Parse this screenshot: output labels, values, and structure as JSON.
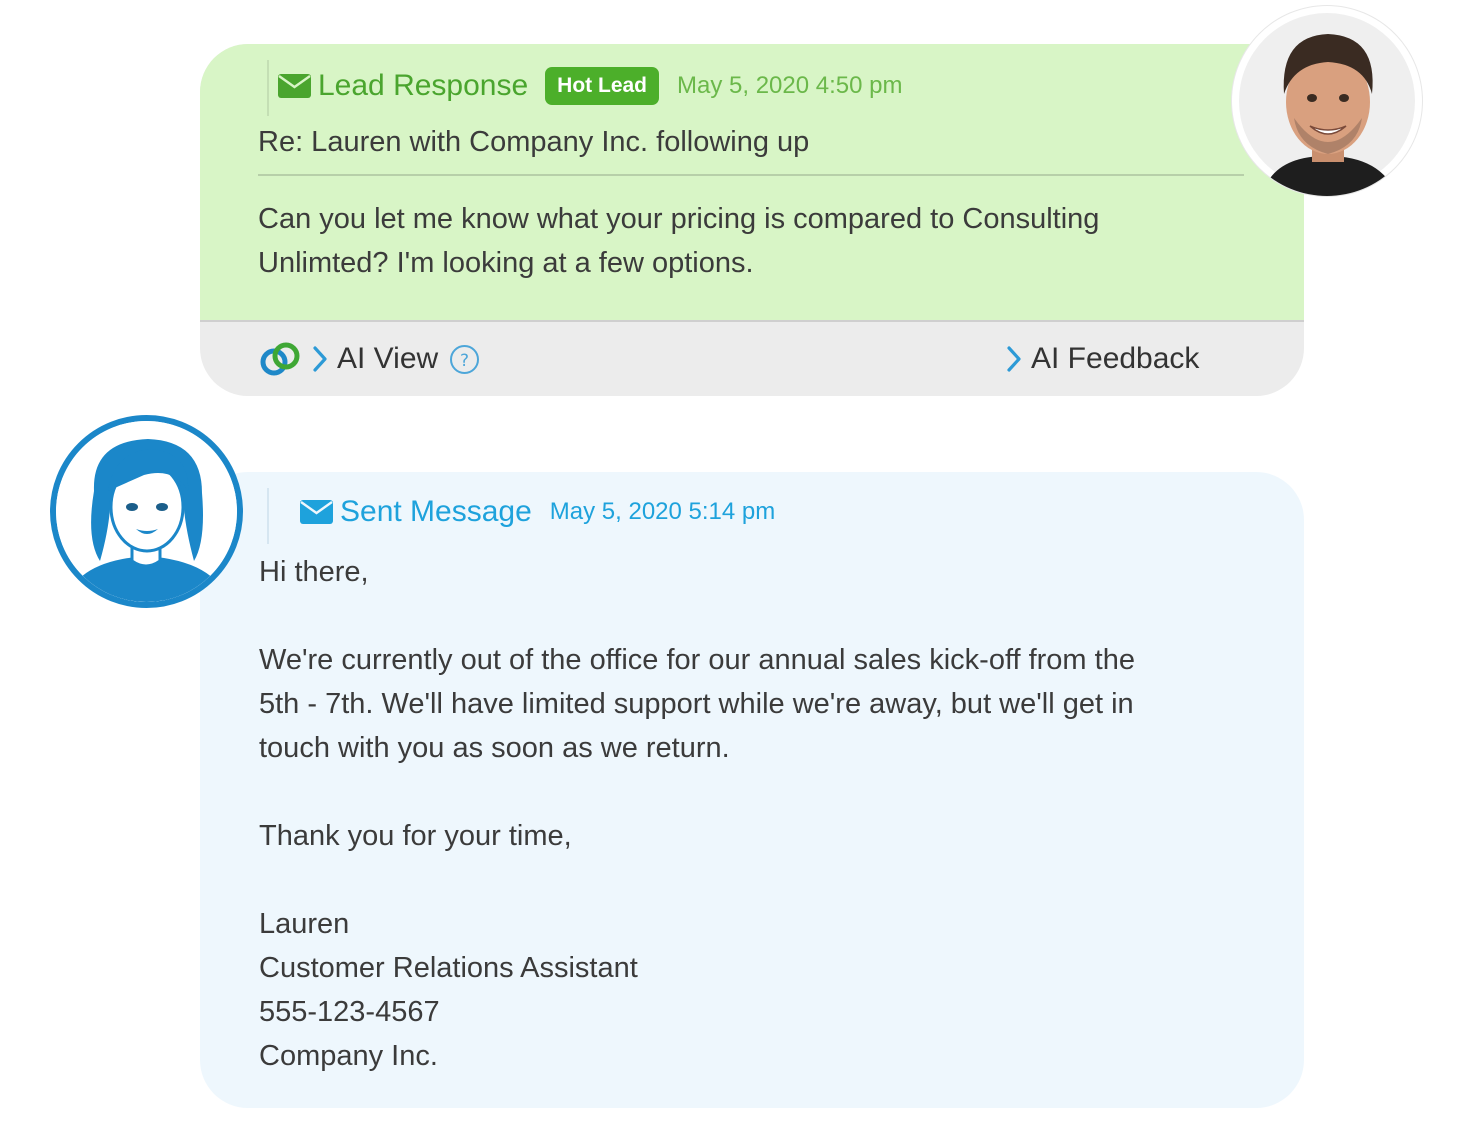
{
  "lead_response": {
    "title": "Lead Response",
    "badge": "Hot Lead",
    "timestamp": "May 5, 2020 4:50 pm",
    "subject": "Re: Lauren with Company Inc. following up",
    "message": "Can you let me know what your pricing is compared to Consulting Unlimted? I'm looking at a few options.",
    "footer": {
      "ai_view_label": "AI View",
      "ai_feedback_label": "AI Feedback"
    },
    "icons": [
      "envelope-icon",
      "ai-logo-icon",
      "chevron-right-icon",
      "help-icon"
    ],
    "colors": {
      "background": "#d8f5c6",
      "accent": "#4aa52e",
      "badge": "#4caf2a",
      "footer": "#ececec"
    }
  },
  "sent_message": {
    "title": "Sent Message",
    "timestamp": "May 5, 2020 5:14 pm",
    "body": {
      "greeting": "Hi there,",
      "para_line1": "We're currently out of the office for our annual sales kick-off from the",
      "para_line2": "5th - 7th. We'll have limited support while we're away, but we'll get in",
      "para_line3": "touch with you as soon as we return.",
      "closing": "Thank you for your time,",
      "sig_name": "Lauren",
      "sig_title": "Customer Relations Assistant",
      "sig_phone": "555-123-4567",
      "sig_company": "Company Inc."
    },
    "icons": [
      "envelope-icon"
    ],
    "colors": {
      "background": "#eef7fd",
      "accent": "#1ea2dc"
    }
  }
}
